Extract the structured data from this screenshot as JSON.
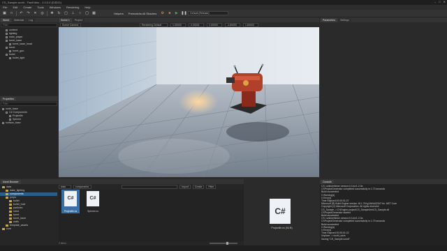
{
  "title": "CS_Sample.world - FlaxEditor - 1.0.0.0 (D3D11)",
  "menu": [
    "File",
    "Edit",
    "Create",
    "Tools",
    "Windows",
    "Rendering",
    "Help"
  ],
  "toolbar": {
    "helpers": "Helpers",
    "preset": "Prematchs All Shaders",
    "mode": "Default (Release)"
  },
  "left_panel": {
    "tabs": [
      "World",
      "Materials",
      "Log"
    ],
    "search_placeholder": "Filter",
    "tree": [
      {
        "label": "content",
        "depth": 1
      },
      {
        "label": "lighting",
        "depth": 1
      },
      {
        "label": "main_player",
        "depth": 1
      },
      {
        "label": "turret_base",
        "depth": 1
      },
      {
        "label": "turret_base_head",
        "depth": 2
      },
      {
        "label": "turret",
        "depth": 1
      },
      {
        "label": "turret_gun",
        "depth": 2
      },
      {
        "label": "bullet",
        "depth": 1
      },
      {
        "label": "bullet_light",
        "depth": 2
      }
    ]
  },
  "properties": {
    "tab": "Properties",
    "search_placeholder": "Filter",
    "tree": [
      {
        "label": "node_base",
        "depth": 0
      },
      {
        "label": "C# Components",
        "depth": 1
      },
      {
        "label": "Projectile",
        "depth": 2
      },
      {
        "label": "Spinner",
        "depth": 2
      },
      {
        "label": "surface_base",
        "depth": 0
      }
    ]
  },
  "viewport": {
    "tabs": [
      "Scene 1",
      "Project"
    ],
    "camera": "Scene Camera",
    "render_mode": "Rendering Default",
    "fields": [
      "1.00000",
      "0.33331",
      "1.00000",
      "-1.60000",
      "1.60000"
    ]
  },
  "right_panel": {
    "tabs": [
      "Parameters",
      "Settings"
    ]
  },
  "asset_browser": {
    "tab": "Asset Browser",
    "path": [
      "data",
      "components"
    ],
    "search_placeholder": "",
    "buttons": [
      "Import",
      "Create",
      "Filter"
    ],
    "tree": [
      {
        "label": "data",
        "depth": 0,
        "sel": false
      },
      {
        "label": "bake_lighting",
        "depth": 1,
        "sel": false
      },
      {
        "label": "components",
        "depth": 1,
        "sel": true
      },
      {
        "label": "props",
        "depth": 1,
        "sel": false
      },
      {
        "label": "bullet",
        "depth": 2,
        "sel": false
      },
      {
        "label": "bullet_hole",
        "depth": 2,
        "sel": false
      },
      {
        "label": "particles",
        "depth": 2,
        "sel": false
      },
      {
        "label": "robot",
        "depth": 2,
        "sel": false
      },
      {
        "label": "turret",
        "depth": 2,
        "sel": false
      },
      {
        "label": "turret_laser",
        "depth": 2,
        "sel": false
      },
      {
        "label": "walls",
        "depth": 2,
        "sel": false
      },
      {
        "label": "template_assets",
        "depth": 1,
        "sel": false
      },
      {
        "label": "core",
        "depth": 0,
        "sel": false
      }
    ],
    "files": [
      {
        "label": "Projectile.cs",
        "selected": true
      },
      {
        "label": "Spinner.cs",
        "selected": false
      }
    ],
    "status": "2 items"
  },
  "preview": {
    "icon": "C#",
    "caption": "Projectile.cs (94 B)"
  },
  "console": {
    "tab": "Console",
    "lines": [
      "CS: runtime/linker version:0.3.4c/1.2.0a",
      "CSProjectGenerator completed successfully in 1.73 seconds",
      "Build succeeded",
      "0 Warning(s)",
      "0 Error(s)",
      "Time Elapsed 00:00:01.07",
      "Microsoft (R) Build Engine version 16.1.76+g14b0a322d7 for .NET Core",
      "Copyright (C) Microsoft Corporation. All rights reserved.",
      "CS_Sample -> D:\\Engine.project\\CS_Sample\\bin\\CS_Sample.dll",
      "CSProjectGenerator started",
      "Build succeeded",
      "CS: runtime/linker version:0.3.4c/1.2.0a",
      "CSProjectGenerator completed successfully in 1.79 seconds",
      "Build succeeded",
      "0 Warning(s)",
      "0 Error(s)",
      "Time Elapsed 00:00:01.02",
      "Unplace -> world_save",
      "Saving \"CS_Sample.world\""
    ]
  },
  "colors": {
    "accent": "#2d5d8b",
    "select": "#3a6ea5",
    "floor": "#8c98a6",
    "turret": "#b0402a"
  }
}
